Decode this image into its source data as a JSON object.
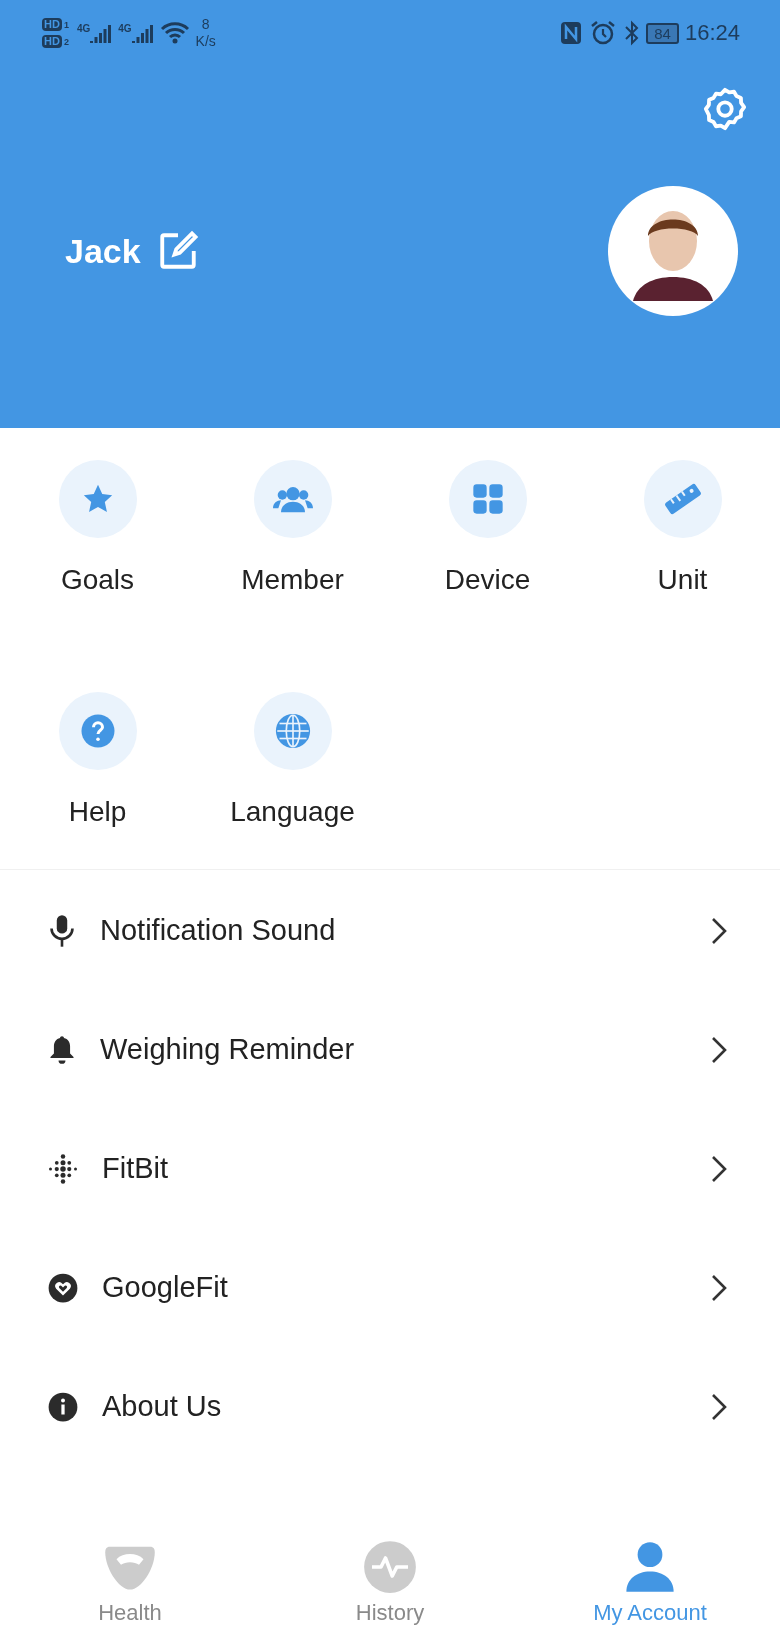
{
  "status_bar": {
    "sims": [
      {
        "badge": "HD",
        "slot": "1",
        "network": "4G"
      },
      {
        "badge": "HD",
        "slot": "2",
        "network": "4G"
      }
    ],
    "speed_value": "8",
    "speed_unit": "K/s",
    "battery": "84",
    "time": "16:24"
  },
  "profile": {
    "name": "Jack"
  },
  "shortcuts": [
    {
      "kind": "star",
      "label": "Goals"
    },
    {
      "kind": "people",
      "label": "Member"
    },
    {
      "kind": "grid",
      "label": "Device"
    },
    {
      "kind": "ruler",
      "label": "Unit"
    },
    {
      "kind": "help",
      "label": "Help"
    },
    {
      "kind": "globe",
      "label": "Language"
    }
  ],
  "menu": [
    {
      "kind": "mic",
      "label": "Notification Sound"
    },
    {
      "kind": "bell",
      "label": "Weighing Reminder"
    },
    {
      "kind": "dots",
      "label": "FitBit"
    },
    {
      "kind": "heart",
      "label": "GoogleFit"
    },
    {
      "kind": "info",
      "label": "About Us"
    }
  ],
  "tabs": [
    {
      "kind": "scale",
      "label": "Health",
      "selected": false
    },
    {
      "kind": "pulse",
      "label": "History",
      "selected": false
    },
    {
      "kind": "person",
      "label": "My Account",
      "selected": true
    }
  ]
}
